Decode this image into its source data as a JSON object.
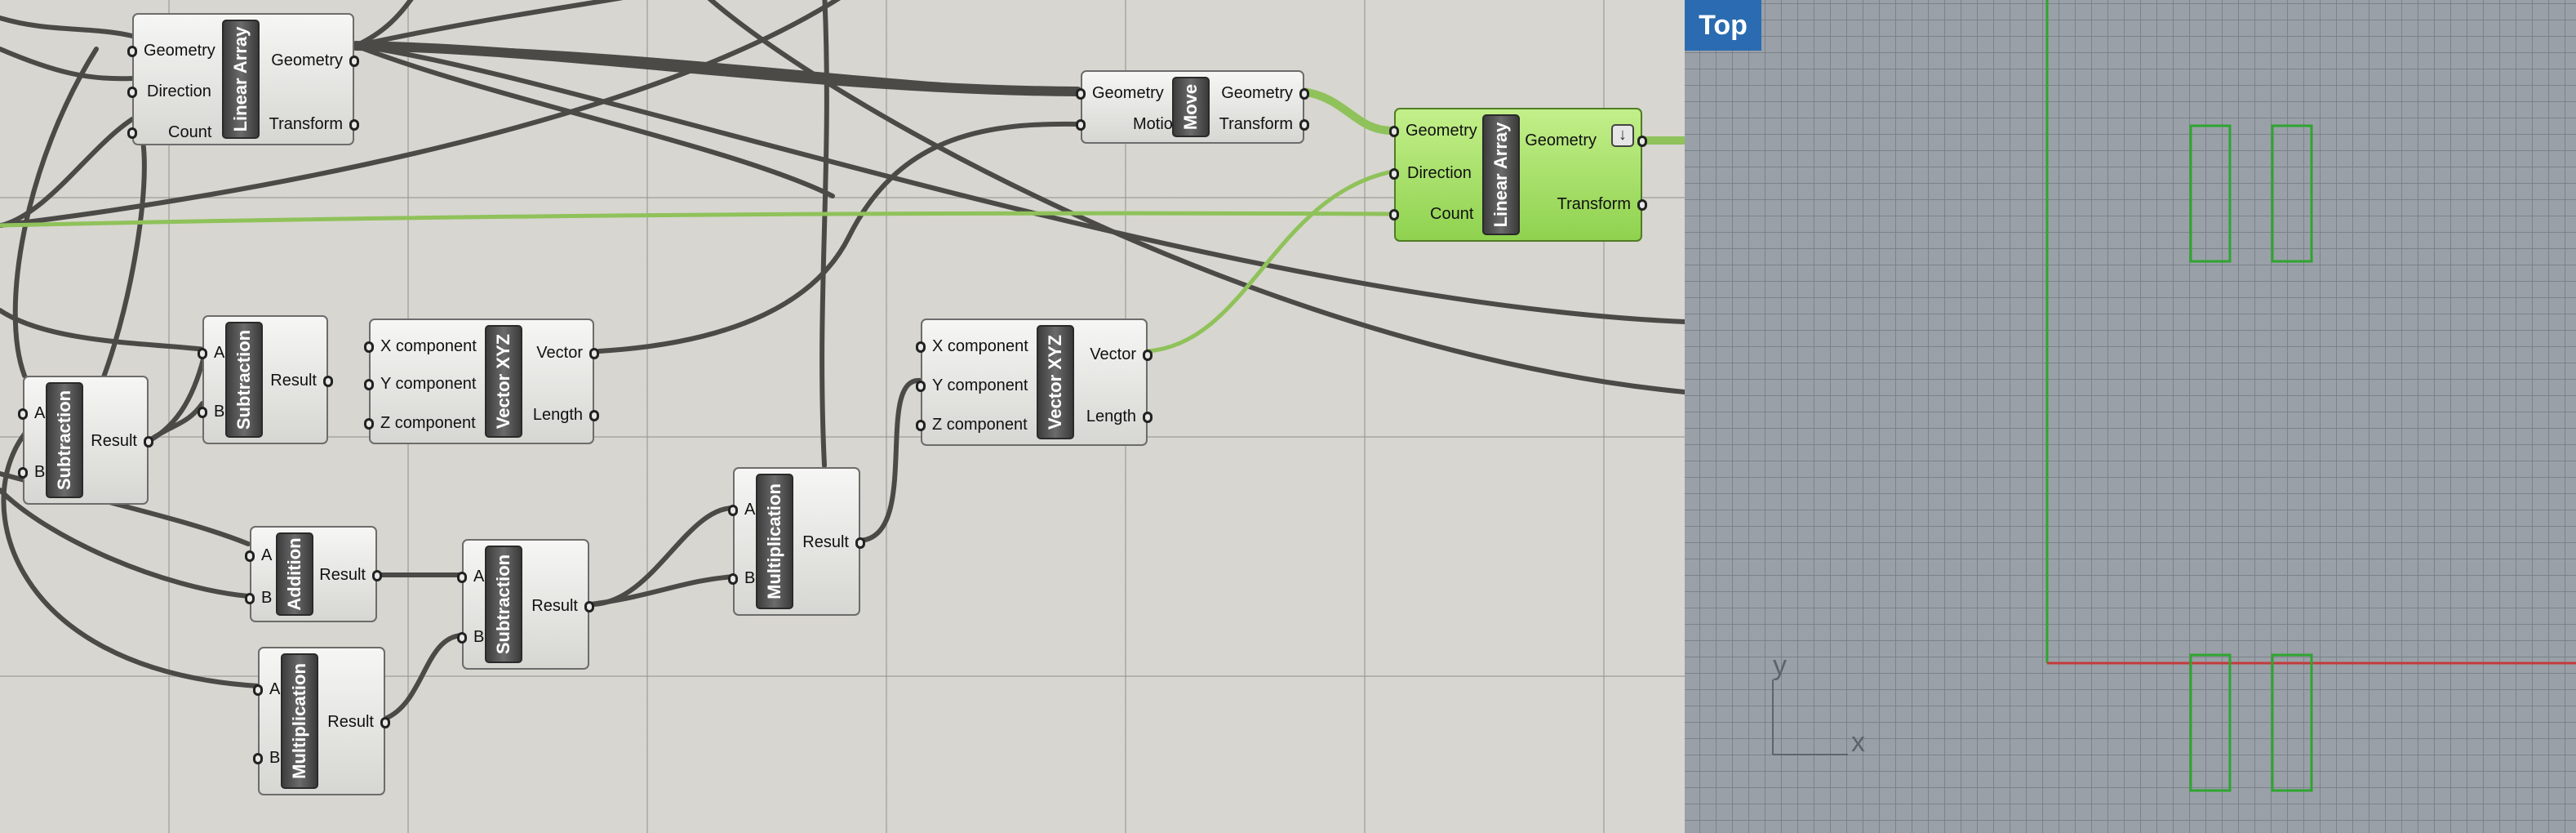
{
  "components": {
    "linear_array_1": {
      "title": "Linear Array",
      "inputs": [
        "Geometry",
        "Direction",
        "Count"
      ],
      "outputs": [
        "Geometry",
        "Transform"
      ]
    },
    "move": {
      "title": "Move",
      "inputs": [
        "Geometry",
        "Motion"
      ],
      "outputs": [
        "Geometry",
        "Transform"
      ]
    },
    "linear_array_2": {
      "title": "Linear Array",
      "inputs": [
        "Geometry",
        "Direction",
        "Count"
      ],
      "outputs": [
        "Geometry",
        "Transform"
      ]
    },
    "subtraction_1": {
      "title": "Subtraction",
      "inputs": [
        "A",
        "B"
      ],
      "outputs": [
        "Result"
      ]
    },
    "subtraction_2": {
      "title": "Subtraction",
      "inputs": [
        "A",
        "B"
      ],
      "outputs": [
        "Result"
      ]
    },
    "vector_xyz_1": {
      "title": "Vector XYZ",
      "inputs": [
        "X component",
        "Y component",
        "Z component"
      ],
      "outputs": [
        "Vector",
        "Length"
      ]
    },
    "vector_xyz_2": {
      "title": "Vector XYZ",
      "inputs": [
        "X component",
        "Y component",
        "Z component"
      ],
      "outputs": [
        "Vector",
        "Length"
      ]
    },
    "addition": {
      "title": "Addition",
      "inputs": [
        "A",
        "B"
      ],
      "outputs": [
        "Result"
      ]
    },
    "subtraction_3": {
      "title": "Subtraction",
      "inputs": [
        "A",
        "B"
      ],
      "outputs": [
        "Result"
      ]
    },
    "multiplication_1": {
      "title": "Multiplication",
      "inputs": [
        "A",
        "B"
      ],
      "outputs": [
        "Result"
      ]
    },
    "multiplication_2": {
      "title": "Multiplication",
      "inputs": [
        "A",
        "B"
      ],
      "outputs": [
        "Result"
      ]
    }
  },
  "viewport": {
    "name": "Top",
    "axis_x": "x",
    "axis_y": "y"
  },
  "colors": {
    "canvas": "#d8d6d0",
    "wire": "#4b4a47",
    "wire_selected": "#8fc25a",
    "component_selected": "#a6df66",
    "viewport_bg": "#9aa0a8",
    "tab": "#2a6bb1",
    "geometry": "#2fa52f",
    "x_axis": "#c23b3b",
    "y_axis": "#2fa52f"
  }
}
